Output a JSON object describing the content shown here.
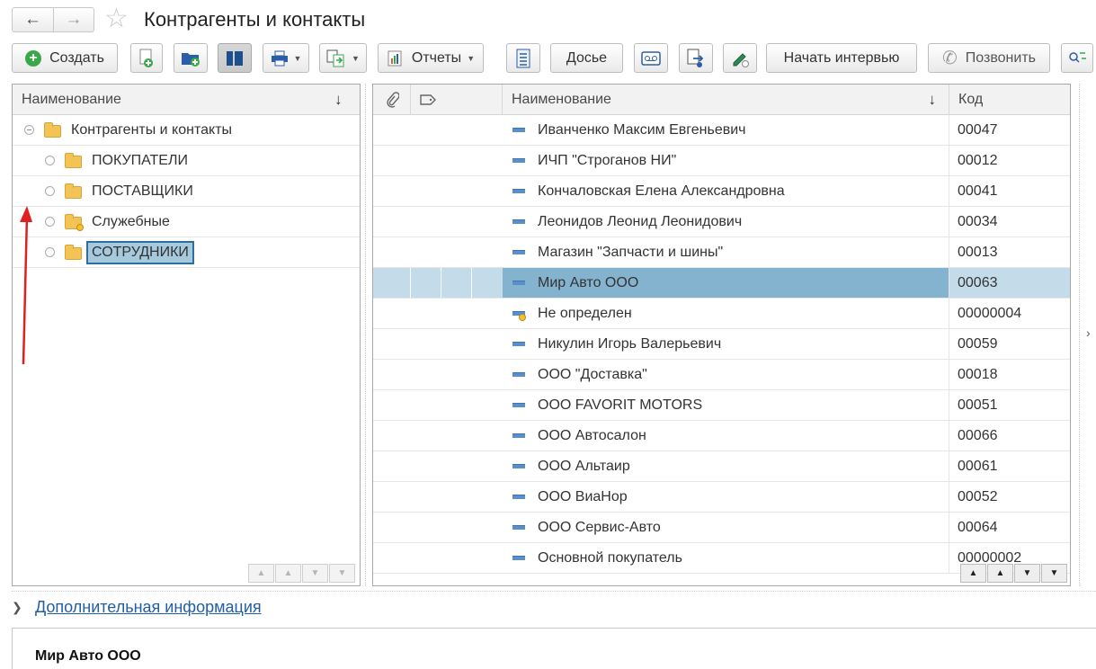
{
  "window": {
    "title": "Контрагенты и контакты",
    "favorite_icon": "star-icon"
  },
  "toolbar": {
    "create_label": "Создать",
    "reports_label": "Отчеты",
    "dossier_label": "Досье",
    "interview_label": "Начать интервью",
    "call_label": "Позвонить"
  },
  "tree": {
    "column_header": "Наименование",
    "sort_indicator": "↓",
    "root": "Контрагенты и контакты",
    "items": [
      {
        "label": "ПОКУПАТЕЛИ",
        "selected": false
      },
      {
        "label": "ПОСТАВЩИКИ",
        "selected": false
      },
      {
        "label": "Служебные",
        "selected": false
      },
      {
        "label": "СОТРУДНИКИ",
        "selected": true
      }
    ]
  },
  "list": {
    "columns": {
      "name": "Наименование",
      "code": "Код",
      "sort_indicator": "↓"
    },
    "rows": [
      {
        "name": "Иванченко  Максим Евгеньевич",
        "code": "00047"
      },
      {
        "name": "ИЧП \"Строганов НИ\"",
        "code": "00012"
      },
      {
        "name": "Кончаловская  Елена  Александровна",
        "code": "00041"
      },
      {
        "name": "Леонидов Леонид Леонидович",
        "code": "00034"
      },
      {
        "name": "Магазин \"Запчасти и шины\"",
        "code": "00013"
      },
      {
        "name": "Мир Авто ООО",
        "code": "00063"
      },
      {
        "name": "Не определен",
        "code": "00000004"
      },
      {
        "name": "Никулин Игорь Валерьевич",
        "code": "00059"
      },
      {
        "name": "ООО \"Доставка\"",
        "code": "00018"
      },
      {
        "name": "ООО FAVORIT MOTORS",
        "code": "00051"
      },
      {
        "name": "ООО Автосалон",
        "code": "00066"
      },
      {
        "name": "ООО Альтаир",
        "code": "00061"
      },
      {
        "name": "ООО ВиаНор",
        "code": "00052"
      },
      {
        "name": "ООО Сервис-Авто",
        "code": "00064"
      },
      {
        "name": "Основной покупатель",
        "code": "00000002"
      }
    ]
  },
  "details": {
    "link_label": "Дополнительная информация",
    "title": "Мир Авто ООО"
  },
  "colors": {
    "accent": "#1f5fa8",
    "selection": "#84b3d0",
    "annotation_arrow": "#e02020"
  }
}
